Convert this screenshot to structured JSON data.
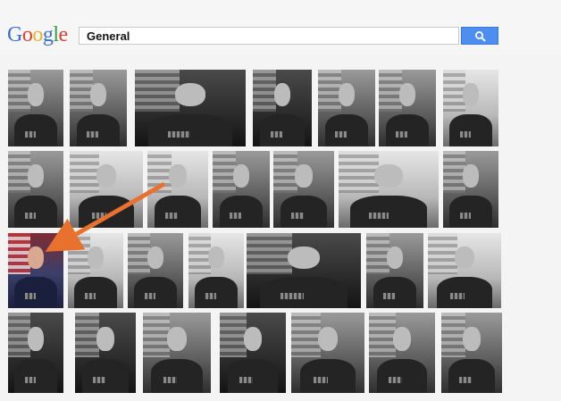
{
  "logo": {
    "letters": [
      {
        "ch": "G",
        "cls": "b"
      },
      {
        "ch": "o",
        "cls": "r"
      },
      {
        "ch": "o",
        "cls": "y"
      },
      {
        "ch": "g",
        "cls": "b"
      },
      {
        "ch": "l",
        "cls": "g"
      },
      {
        "ch": "e",
        "cls": "r"
      }
    ]
  },
  "search": {
    "query": "General",
    "button_icon": "search-icon"
  },
  "colors": {
    "search_button": "#4d8ef0",
    "arrow": "#e8712e",
    "highlight_tile": "#7c2d34"
  },
  "results": {
    "rows": [
      {
        "tiles": [
          {
            "style": "normal"
          },
          {
            "style": "normal"
          },
          {
            "style": "dark"
          },
          {
            "style": "dark"
          },
          {
            "style": "normal"
          },
          {
            "style": "normal"
          },
          {
            "style": "light"
          }
        ]
      },
      {
        "tiles": [
          {
            "style": "normal"
          },
          {
            "style": "light"
          },
          {
            "style": "light"
          },
          {
            "style": "normal"
          },
          {
            "style": "normal"
          },
          {
            "style": "light"
          },
          {
            "style": "normal"
          }
        ]
      },
      {
        "tiles": [
          {
            "style": "color"
          },
          {
            "style": "light"
          },
          {
            "style": "normal"
          },
          {
            "style": "light"
          },
          {
            "style": "dark"
          },
          {
            "style": "normal"
          },
          {
            "style": "light"
          }
        ]
      },
      {
        "tiles": [
          {
            "style": "dark"
          },
          {
            "style": "dark"
          },
          {
            "style": "normal"
          },
          {
            "style": "dark"
          },
          {
            "style": "normal"
          },
          {
            "style": "normal"
          },
          {
            "style": "normal"
          }
        ]
      }
    ]
  }
}
